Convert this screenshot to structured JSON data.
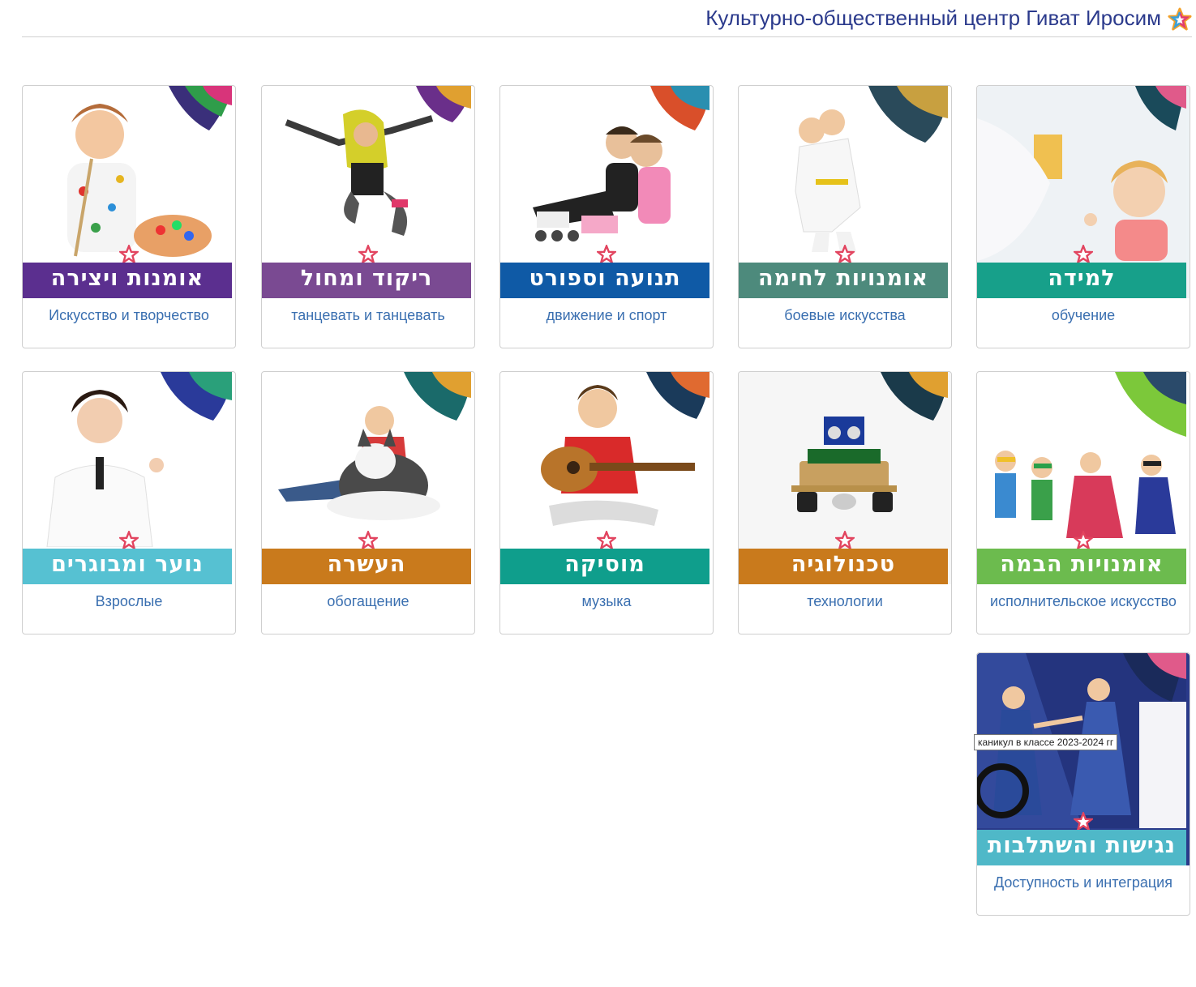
{
  "header": {
    "title": "Культурно-общественный центр Гиват Иросим"
  },
  "cards": [
    {
      "hebrew": "אומנות ויצירה",
      "caption": "Искусство и творчество",
      "color": "#5b2f8f",
      "bg": "#ffffff"
    },
    {
      "hebrew": "ריקוד ומחול",
      "caption": "танцевать и танцевать",
      "color": "#7a4a92",
      "bg": "#ffffff"
    },
    {
      "hebrew": "תנועה וספורט",
      "caption": "движение и спорт",
      "color": "#0f5aa6",
      "bg": "#ffffff"
    },
    {
      "hebrew": "אומנויות לחימה",
      "caption": "боевые искусства",
      "color": "#4d8a7c",
      "bg": "#ffffff"
    },
    {
      "hebrew": "למידה",
      "caption": "обучение",
      "color": "#17a08a",
      "bg": "#eef3f6"
    },
    {
      "hebrew": "נוער ומבוגרים",
      "caption": "Взрослые",
      "color": "#56c1d2",
      "bg": "#ffffff"
    },
    {
      "hebrew": "העשרה",
      "caption": "обогащение",
      "color": "#c97a1c",
      "bg": "#ffffff"
    },
    {
      "hebrew": "מוסיקה",
      "caption": "музыка",
      "color": "#0f9e8c",
      "bg": "#ffffff"
    },
    {
      "hebrew": "טכנולוגיה",
      "caption": "технологии",
      "color": "#c97a1c",
      "bg": "#f6f6f6"
    },
    {
      "hebrew": "אומנויות הבמה",
      "caption": "исполнительское искусство",
      "color": "#6cbb4e",
      "bg": "#ffffff"
    },
    {
      "hebrew": "נגישות והשתלבות",
      "caption": "Доступность и интеграция",
      "color": "#4fb8c8",
      "bg": "#2a3a8a"
    }
  ],
  "tooltip": {
    "text": "каникул в классе 2023-2024 гг"
  }
}
